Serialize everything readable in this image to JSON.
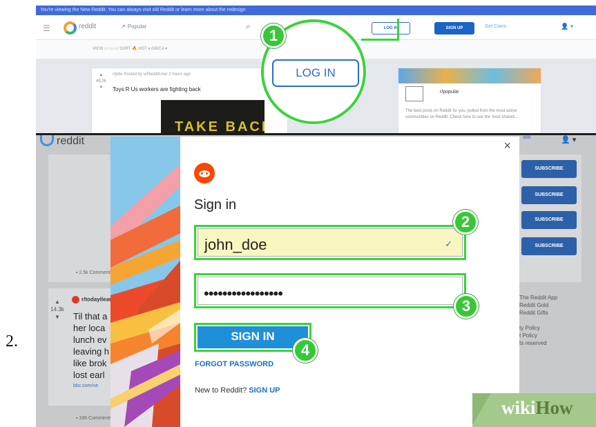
{
  "step_number": "2.",
  "top_panel": {
    "banner_text": "You're viewing the New Reddit. You can always visit old Reddit or learn more about the redesign",
    "logo_text": "reddit",
    "nav_popular": "Popular",
    "login_small": "LOG IN",
    "signup_small": "SIGN UP",
    "coins_text": "Get Coins",
    "subnav_text": "VIEW  ▭ ▭ ▭     SORT  🔥 HOT  ▾   GB/CA  ▾",
    "post": {
      "votes": "45.2k",
      "meta": "r/jobs  Posted by u/RedditUser 2 hours ago",
      "title": "Toys R Us workers are fighting back",
      "image_text": "TAKE BACK"
    },
    "side_card": {
      "title": "r/popular",
      "text": "The best posts on Reddit for you, pulled from the most active communities on Reddit. Check here to see the most shared..."
    },
    "zoom_label": "LOG IN"
  },
  "badges": [
    "1",
    "2",
    "3",
    "4"
  ],
  "bottom_panel": {
    "logo_text": "reddit",
    "comments_1": "2.5k Comments",
    "post_votes": "14.3k",
    "post_sub": "r/todayilearned",
    "post_lines": [
      "Til that a",
      "her loca",
      "lunch ev",
      "leaving h",
      "like brok",
      "lost earl"
    ],
    "post_link": "bbc.com/ne",
    "comments_2": "336 Comments",
    "subscribe_label": "SUBSCRIBE",
    "right_list": [
      "The Reddit App",
      "Reddit Gold",
      "Reddit Gifts",
      "",
      "ty Policy",
      "t Policy",
      "ts reserved"
    ]
  },
  "modal": {
    "heading": "Sign in",
    "username_value": "john_doe",
    "password_mask": "•••••••••••••••••",
    "signin_label": "SIGN IN",
    "forgot_label": "FORGOT PASSWORD",
    "new_to_text": "New to Reddit?",
    "signup_link": "SIGN UP",
    "close_glyph": "×"
  },
  "watermark": {
    "wiki": "wiki",
    "how": "How"
  },
  "colors": {
    "highlight_green": "#3ad33a",
    "reddit_orange": "#ff4500",
    "primary_blue": "#1f8fd8",
    "link_blue": "#1a6fc4"
  }
}
